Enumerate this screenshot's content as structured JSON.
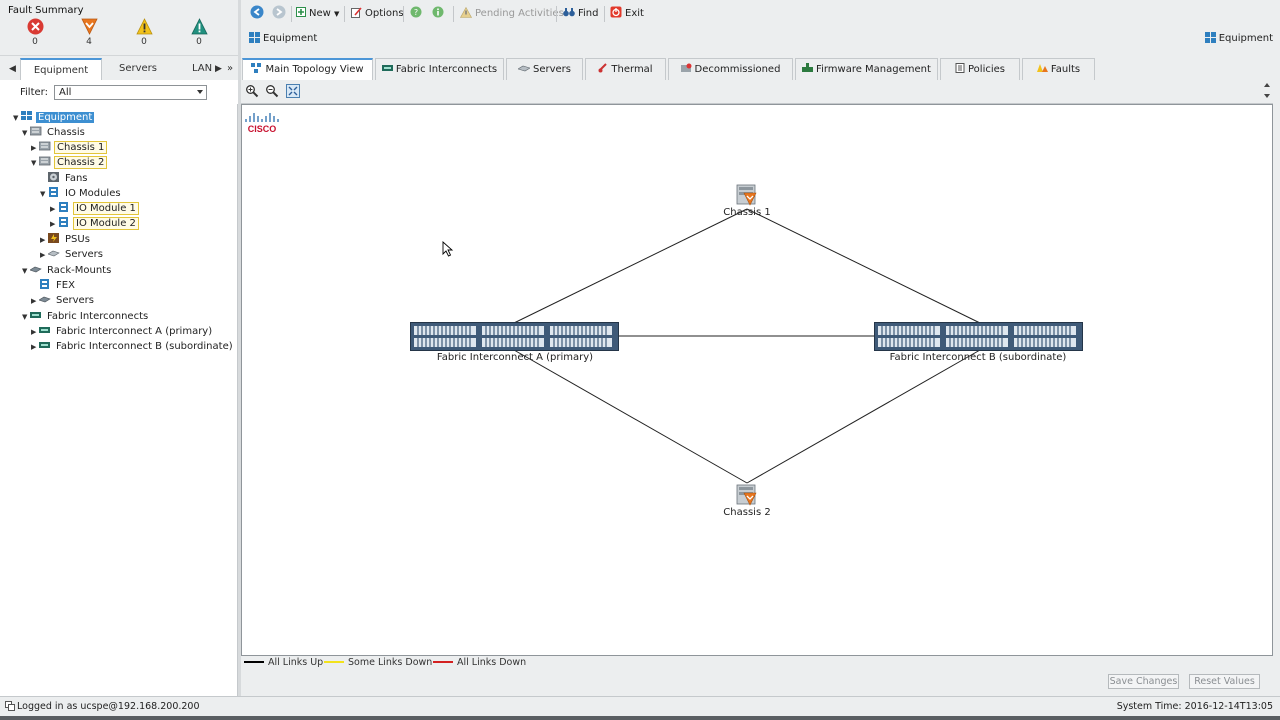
{
  "fault_summary": {
    "title": "Fault Summary",
    "critical": "0",
    "major": "4",
    "minor": "0",
    "warning": "0",
    "colors": {
      "critical": "#d93a33",
      "major": "#e8761f",
      "minor": "#f2c21b",
      "warning": "#21907f"
    }
  },
  "nav_tabs": {
    "equipment": "Equipment",
    "servers": "Servers",
    "lan": "LAN"
  },
  "filter": {
    "label": "Filter:",
    "value": "All"
  },
  "tree": {
    "equipment": "Equipment",
    "chassis": "Chassis",
    "chassis1": "Chassis 1",
    "chassis2": "Chassis 2",
    "fans": "Fans",
    "io_modules": "IO Modules",
    "io_module1": "IO Module 1",
    "io_module2": "IO Module 2",
    "psus": "PSUs",
    "chassis_servers": "Servers",
    "rack_mounts": "Rack-Mounts",
    "fex": "FEX",
    "rack_servers": "Servers",
    "fabric_interconnects": "Fabric Interconnects",
    "fi_a": "Fabric Interconnect A (primary)",
    "fi_b": "Fabric Interconnect B (subordinate)"
  },
  "toolbar": {
    "new": "New",
    "options": "Options",
    "pending": "Pending Activities",
    "find": "Find",
    "exit": "Exit"
  },
  "breadcrumb": "Equipment",
  "breadcrumb_right": "Equipment",
  "content_tabs": {
    "topology": "Main Topology View",
    "fabric": "Fabric Interconnects",
    "servers": "Servers",
    "thermal": "Thermal",
    "decommissioned": "Decommissioned",
    "firmware": "Firmware Management",
    "policies": "Policies",
    "faults": "Faults"
  },
  "topology": {
    "logo": "CISCO",
    "chassis1": "Chassis 1",
    "chassis2": "Chassis 2",
    "fi_a": "Fabric Interconnect A (primary)",
    "fi_b": "Fabric Interconnect B (subordinate)"
  },
  "legend": {
    "up": "All Links Up",
    "some_down": "Some Links Down",
    "down": "All Links Down",
    "colors": {
      "up": "#000000",
      "some_down": "#f2e21b",
      "down": "#d32020"
    }
  },
  "buttons": {
    "save": "Save Changes",
    "reset": "Reset Values"
  },
  "status": {
    "logged_in": "Logged in as ucspe@192.168.200.200",
    "system_time": "System Time: 2016-12-14T13:05"
  }
}
